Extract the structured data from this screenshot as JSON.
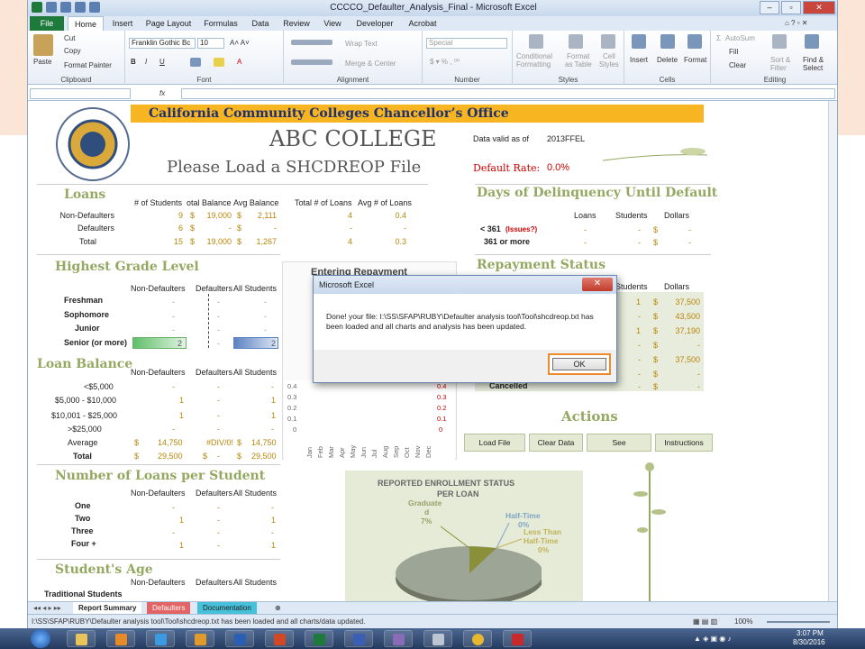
{
  "window": {
    "title": "CCCCO_Defaulter_Analysis_Final - Microsoft Excel"
  },
  "tabs": [
    "File",
    "Home",
    "Insert",
    "Page Layout",
    "Formulas",
    "Data",
    "Review",
    "View",
    "Developer",
    "Acrobat"
  ],
  "ribbon": {
    "clipboard": {
      "paste": "Paste",
      "cut": "Cut",
      "copy": "Copy",
      "format_painter": "Format Painter",
      "label": "Clipboard"
    },
    "font": {
      "name": "Franklin Gothic Bc",
      "size": "10",
      "label": "Font"
    },
    "alignment": {
      "wrap_text": "Wrap Text",
      "merge_center": "Merge & Center",
      "label": "Alignment"
    },
    "number": {
      "format": "Special",
      "label": "Number"
    },
    "styles": {
      "conditional": "Conditional",
      "conditional2": "Formatting",
      "format_as": "Format",
      "format_as2": "as Table",
      "cell_styles": "Cell",
      "cell_styles2": "Styles",
      "label": "Styles"
    },
    "cells": {
      "insert": "Insert",
      "delete": "Delete",
      "format": "Format",
      "label": "Cells"
    },
    "editing": {
      "autosum": "AutoSum",
      "fill": "Fill",
      "clear": "Clear",
      "sort1": "Sort &",
      "sort2": "Filter",
      "find1": "Find &",
      "find2": "Select",
      "label": "Editing"
    }
  },
  "formula_bar": {
    "fx": "fx"
  },
  "sheet": {
    "banner": "California Community Colleges Chancellor’s Office",
    "college": "ABC COLLEGE",
    "prompt": "Please Load a SHCDREOP File",
    "data_valid_label": "Data valid as of",
    "data_valid_value": "2013FFEL",
    "default_rate_label": "Default Rate:",
    "default_rate_value": "0.0%",
    "loans": {
      "title": "Loans",
      "headers": [
        "# of Students",
        "otal Balance",
        "Avg Balance",
        "Total # of Loans",
        "Avg # of Loans"
      ],
      "rows": [
        {
          "label": "Non-Defaulters",
          "students": "9",
          "total": "19,000",
          "avg": "2,111",
          "nloans": "4",
          "avgloans": "0.4"
        },
        {
          "label": "Defaulters",
          "students": "6",
          "total": "-",
          "avg": "-",
          "nloans": "-",
          "avgloans": "-"
        },
        {
          "label": "Total",
          "students": "15",
          "total": "19,000",
          "avg": "1,267",
          "nloans": "4",
          "avgloans": "0.3"
        }
      ]
    },
    "delinquency": {
      "title": "Days of Delinquency Until Default",
      "headers": [
        "Loans",
        "Students",
        "Dollars"
      ],
      "rows": [
        {
          "label": "< 361",
          "note": "(Issues?)",
          "loans": "-",
          "students": "-",
          "dollars": "-"
        },
        {
          "label": "361 or more",
          "loans": "-",
          "students": "-",
          "dollars": "-"
        }
      ]
    },
    "grade": {
      "title": "Highest Grade Level",
      "headers": [
        "Non-Defaulters",
        "Defaulters",
        "All Students"
      ],
      "rows": [
        {
          "label": "Freshman",
          "nd": "-",
          "d": "-",
          "all": "-"
        },
        {
          "label": "Sophomore",
          "nd": "-",
          "d": "-",
          "all": "-"
        },
        {
          "label": "Junior",
          "nd": "-",
          "d": "-",
          "all": "-"
        },
        {
          "label": "Senior (or more)",
          "nd": "2",
          "d": "-",
          "all": "2"
        }
      ]
    },
    "entering_repayment": "Entering Repayment",
    "repayment": {
      "title": "Repayment Status",
      "headers": [
        "Students",
        "Dollars"
      ],
      "rows": [
        {
          "students": "1",
          "dollars": "37,500"
        },
        {
          "students": "-",
          "dollars": "43,500"
        },
        {
          "students": "1",
          "dollars": "37,190"
        },
        {
          "students": "-",
          "dollars": "-"
        },
        {
          "students": "-",
          "dollars": "37,500"
        },
        {
          "students": "-",
          "dollars": "-"
        },
        {
          "label": "Cancelled",
          "students": "-",
          "dollars": "-"
        }
      ]
    },
    "balance": {
      "title": "Loan Balance",
      "headers": [
        "Non-Defaulters",
        "Defaulters",
        "All Students"
      ],
      "rows": [
        {
          "label": "<$5,000",
          "nd": "-",
          "d": "-",
          "all": "-"
        },
        {
          "label": "$5,000 - $10,000",
          "nd": "1",
          "d": "-",
          "all": "1"
        },
        {
          "label": "$10,001 - $25,000",
          "nd": "1",
          "d": "-",
          "all": "1"
        },
        {
          "label": ">$25,000",
          "nd": "-",
          "d": "-",
          "all": "-"
        },
        {
          "label": "Average",
          "nd": "14,750",
          "d": "#DIV/0!",
          "all": "14,750"
        },
        {
          "label": "Total",
          "nd": "29,500",
          "d": "-",
          "all": "29,500"
        }
      ]
    },
    "mini_chart": {
      "y_left": [
        "0.4",
        "0.3",
        "0.2",
        "0.1",
        "0"
      ],
      "y_right": [
        "0.4",
        "0.3",
        "0.2",
        "0.1",
        "0"
      ],
      "months": [
        "Jan",
        "Feb",
        "Mar",
        "Apr",
        "May",
        "Jun",
        "Jul",
        "Aug",
        "Sep",
        "Oct",
        "Nov",
        "Dec"
      ]
    },
    "actions": {
      "title": "Actions",
      "buttons": [
        "Load File",
        "Clear Data",
        "See",
        "Instructions"
      ]
    },
    "per_student": {
      "title": "Number of Loans per Student",
      "headers": [
        "Non-Defaulters",
        "Defaulters",
        "All Students"
      ],
      "rows": [
        {
          "label": "One",
          "nd": "-",
          "d": "-",
          "all": "-"
        },
        {
          "label": "Two",
          "nd": "1",
          "d": "-",
          "all": "1"
        },
        {
          "label": "Three",
          "nd": "-",
          "d": "-",
          "all": "-"
        },
        {
          "label": "Four +",
          "nd": "1",
          "d": "-",
          "all": "1"
        }
      ]
    },
    "age": {
      "title": "Student's Age",
      "headers": [
        "Non-Defaulters",
        "Defaulters",
        "All Students"
      ],
      "row_label": "Traditional Students"
    },
    "enrollment_chart": {
      "title1": "REPORTED ENROLLMENT STATUS",
      "title2": "PER LOAN",
      "labels": [
        {
          "l1": "Graduate",
          "l2": "d",
          "l3": "7%"
        },
        {
          "l1": "Half-Time",
          "l2": "0%"
        },
        {
          "l1": "Less Than",
          "l2": "Half-Time",
          "l3": "0%"
        }
      ]
    }
  },
  "sheet_tabs": [
    "Report Summary",
    "Defaulters",
    "Documentation"
  ],
  "status": {
    "message": "I:\\SS\\SFAP\\RUBY\\Defaulter analysis tool\\Tool\\shcdreop.txt has been loaded and all charts/data updated.",
    "zoom": "100%"
  },
  "dialog": {
    "title": "Microsoft Excel",
    "message": "Done! your file: I:\\SS\\SFAP\\RUBY\\Defaulter analysis tool\\Tool\\shcdreop.txt has been loaded and all charts and analysis has been updated.",
    "ok": "OK"
  },
  "taskbar": {
    "time": "3:07 PM",
    "date": "8/30/2016"
  }
}
